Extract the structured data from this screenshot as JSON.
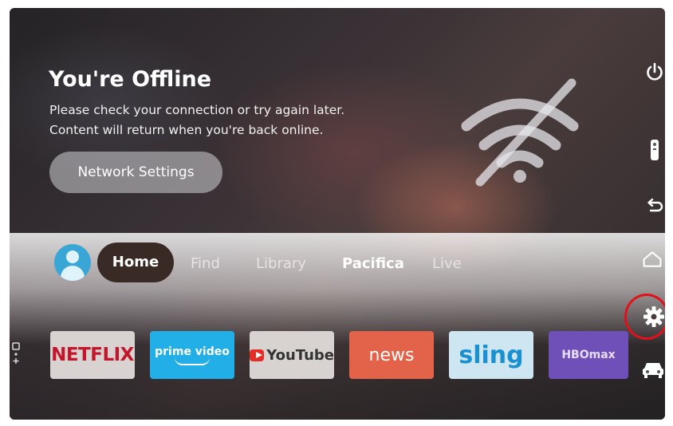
{
  "offline": {
    "title": "You're Offline",
    "message_line1": "Please check your connection or try again later.",
    "message_line2": "Content will return when you're back online.",
    "network_settings_label": "Network Settings",
    "status_icon": "wifi-off-icon"
  },
  "nav": {
    "profile_icon": "user-avatar-icon",
    "items": [
      {
        "label": "Home",
        "selected": true
      },
      {
        "label": "Find"
      },
      {
        "label": "Library"
      },
      {
        "label": "Pacifica"
      },
      {
        "label": "Live"
      }
    ]
  },
  "apps": [
    {
      "name": "NETFLIX",
      "color": "#c4162a"
    },
    {
      "name": "prime video",
      "color": "#22aee6"
    },
    {
      "name": "YouTube",
      "color": "#e52d27"
    },
    {
      "name": "news",
      "color": "#e2634a"
    },
    {
      "name": "sling",
      "color": "#1990cf"
    },
    {
      "name": "HBOmax",
      "color": "#6f4fb8"
    }
  ],
  "remote_buttons": [
    "power-icon",
    "remote-icon",
    "back-icon",
    "home-icon",
    "settings-gear-icon",
    "car-icon"
  ],
  "highlight_color": "#e3101a"
}
